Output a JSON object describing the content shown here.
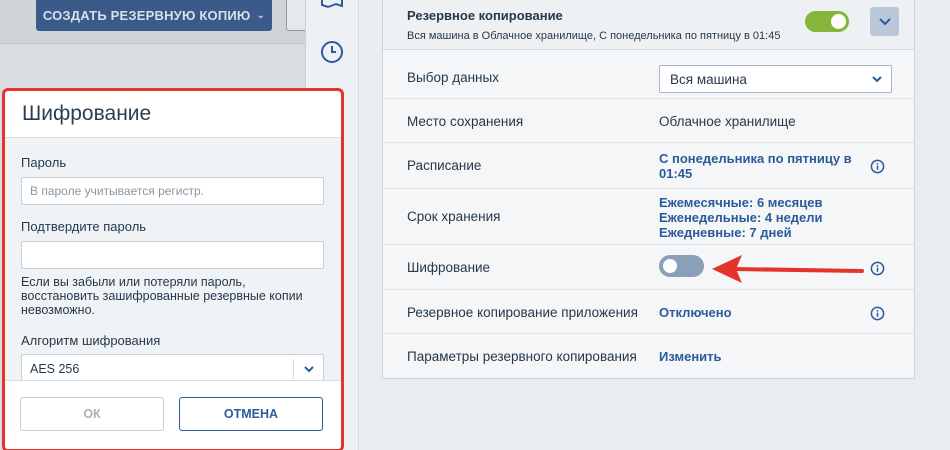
{
  "background": {
    "create_backup_label": "СОЗДАТЬ РЕЗЕРВНУЮ КОПИЮ"
  },
  "plan": {
    "title": "Резервное копирование",
    "subtitle": "Вся машина в Облачное хранилище, С понедельника по пятницу в 01:45",
    "enabled": true
  },
  "rows": {
    "data_selection": {
      "label": "Выбор данных",
      "value": "Вся машина"
    },
    "destination": {
      "label": "Место сохранения",
      "value": "Облачное хранилище"
    },
    "schedule": {
      "label": "Расписание",
      "value_line1": "С понедельника по пятницу в",
      "value_line2": "01:45"
    },
    "retention": {
      "label": "Срок хранения",
      "line1": "Ежемесячные: 6 месяцев",
      "line2": "Еженедельные: 4 недели",
      "line3": "Ежедневные: 7 дней"
    },
    "encryption": {
      "label": "Шифрование",
      "enabled": false
    },
    "app_backup": {
      "label": "Резервное копирование приложения",
      "value": "Отключено"
    },
    "backup_options": {
      "label": "Параметры резервного копирования",
      "value": "Изменить"
    }
  },
  "dialog": {
    "title": "Шифрование",
    "password_label": "Пароль",
    "password_placeholder": "В пароле учитывается регистр.",
    "confirm_label": "Подтвердите пароль",
    "hint": "Если вы забыли или потеряли пароль, восстановить зашифрованные резервные копии невозможно.",
    "algorithm_label": "Алгоритм шифрования",
    "algorithm_value": "AES 256",
    "ok_label": "ОК",
    "cancel_label": "ОТМЕНА"
  },
  "colors": {
    "accent": "#2c5a9b",
    "toggle_on": "#86b53c",
    "toggle_off": "#8a9fb8",
    "highlight": "#e3342c"
  }
}
